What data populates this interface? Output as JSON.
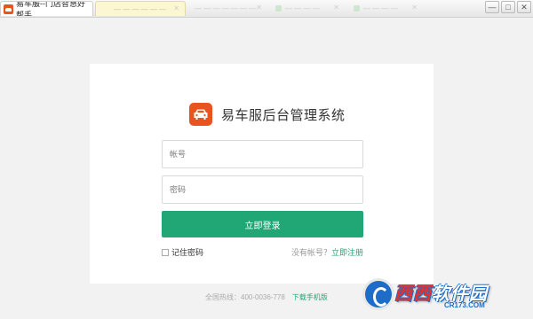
{
  "window": {
    "tabs": [
      {
        "label": "易车服--门店智慧好帮手"
      },
      {
        "label": "— — — — — —"
      },
      {
        "label": "— — — — — — —"
      },
      {
        "label": "— — — —"
      },
      {
        "label": "— — — —"
      }
    ],
    "controls": {
      "minimize": "—",
      "maximize": "□",
      "close": "✕"
    }
  },
  "login": {
    "title": "易车服后台管理系统",
    "account_placeholder": "帐号",
    "password_placeholder": "密码",
    "account_value": "",
    "password_value": "",
    "submit_label": "立即登录",
    "remember_label": "记住密码",
    "no_account_text": "没有帐号？",
    "register_link": "立即注册"
  },
  "footer": {
    "hotline": "全国热线：400-0036-778",
    "download_link": "下载手机版"
  },
  "watermark": {
    "brand_a": "西西",
    "brand_b": "软件园",
    "url": "CR173.COM"
  },
  "colors": {
    "accent": "#21a675",
    "brand": "#e8541e",
    "background": "#f2f2f2",
    "watermark_blue": "#1d6cc7"
  },
  "icons": [
    "car-logo-icon",
    "app-logo-icon",
    "close-icon",
    "minimize-icon",
    "maximize-icon"
  ]
}
